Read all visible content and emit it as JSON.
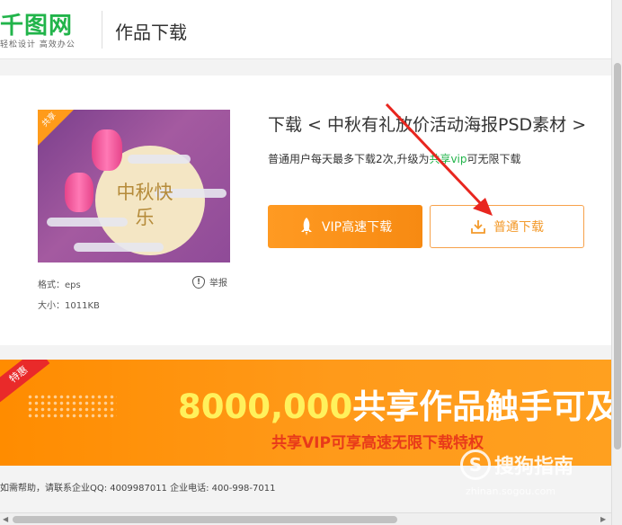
{
  "header": {
    "logo": "千图网",
    "logo_sub": "轻松设计 高效办公",
    "title": "作品下载"
  },
  "product": {
    "thumb_badge": "共享",
    "thumb_text": "中秋快乐",
    "title": "下载 < 中秋有礼放价活动海报PSD素材 >",
    "subtitle_prefix": "普通用户每天最多下载2次,升级为",
    "subtitle_highlight": "共享vip",
    "subtitle_suffix": "可无限下载",
    "format": "格式：eps",
    "size": "大小：1011KB",
    "report_label": "举报"
  },
  "buttons": {
    "vip_label": "VIP高速下载",
    "normal_label": "普通下载"
  },
  "banner": {
    "tag": "特惠",
    "headline_number": "8000,000",
    "headline_rest": "共享作品触手可及",
    "subline": "共享VIP可享高速无限下载特权"
  },
  "footer": {
    "text": "如需帮助，请联系企业QQ: 4009987011 企业电话: 400-998-7011"
  },
  "watermark": {
    "text": "搜狗指南",
    "url": "zhinan.sogou.com"
  },
  "colors": {
    "brand_green": "#21b44a",
    "accent_orange": "#f78a12",
    "arrow_red": "#e8261f"
  }
}
